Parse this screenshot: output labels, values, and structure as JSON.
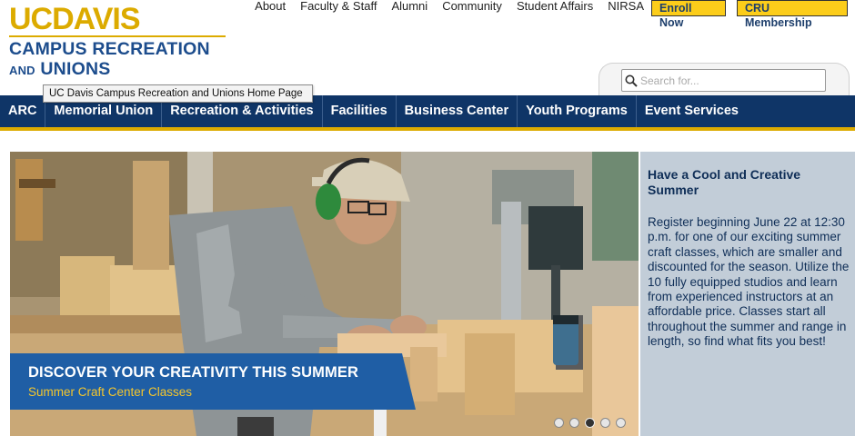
{
  "logo": {
    "brand": "UCDAVIS",
    "line1": "CAMPUS RECREATION",
    "line2_and": "AND",
    "line2_rest": "UNIONS"
  },
  "toplinks": [
    "About",
    "Faculty & Staff",
    "Alumni",
    "Community",
    "Student Affairs",
    "NIRSA"
  ],
  "buttons": {
    "enroll": "Enroll Now",
    "membership": "CRU Membership"
  },
  "search": {
    "placeholder": "Search for...",
    "icon": "search-icon"
  },
  "tooltip": "UC Davis Campus Recreation and Unions Home Page",
  "nav": [
    "ARC",
    "Memorial Union",
    "Recreation & Activities",
    "Facilities",
    "Business Center",
    "Youth Programs",
    "Event Services"
  ],
  "hero": {
    "title": "DISCOVER YOUR CREATIVITY THIS SUMMER",
    "subtitle": "Summer Craft Center Classes",
    "slides_total": 5,
    "active_slide": 3
  },
  "sidebar": {
    "title": "Have a Cool and Creative Summer",
    "body": "Register beginning June 22 at 12:30 p.m. for one of our exciting summer craft classes, which are smaller and discounted for the season. Utilize the 10 fully equipped studios and learn from experienced instructors at an affordable price. Classes start all throughout the summer and range in length, so find what fits you best!"
  },
  "colors": {
    "navy": "#0f3567",
    "gold": "#dcab00",
    "caption_blue": "#1f5ea5",
    "panel": "#c2cdd8"
  }
}
